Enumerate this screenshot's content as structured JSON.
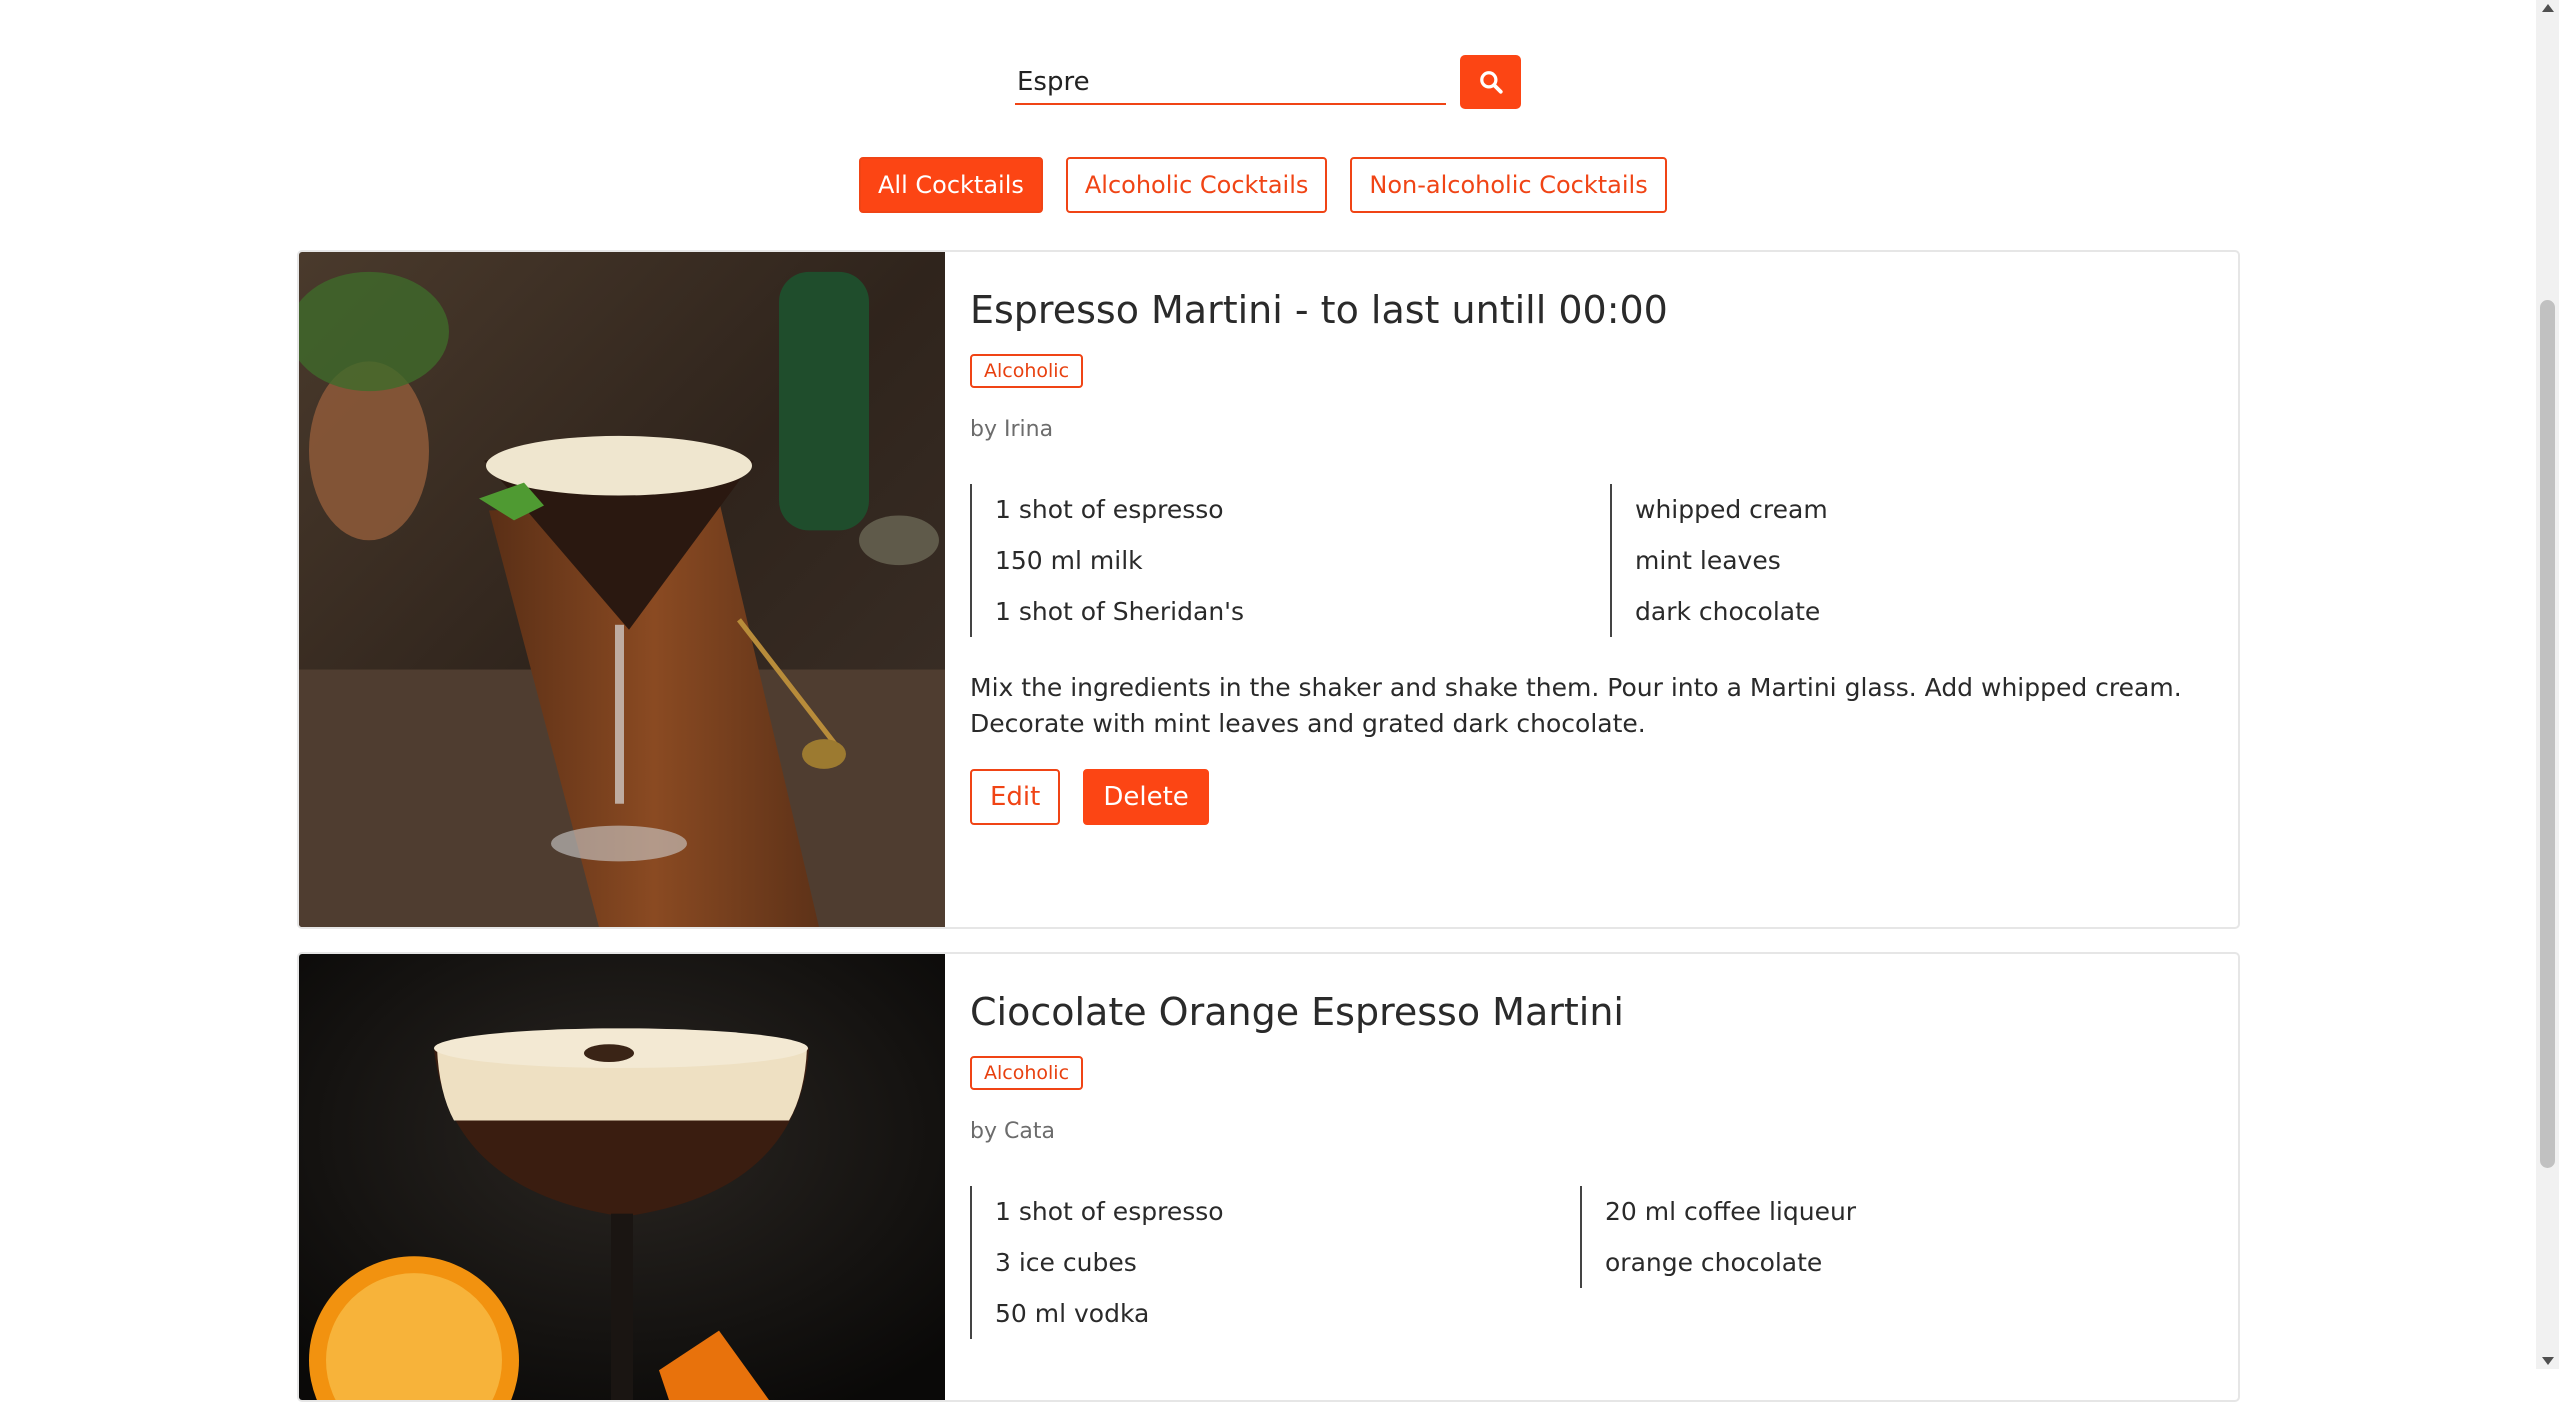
{
  "search": {
    "value": "Espre",
    "placeholder": ""
  },
  "filters": [
    {
      "label": "All Cocktails",
      "active": true
    },
    {
      "label": "Alcoholic Cocktails",
      "active": false
    },
    {
      "label": "Non-alcoholic Cocktails",
      "active": false
    }
  ],
  "cocktails": [
    {
      "title": "Espresso Martini - to last untill 00:00",
      "badge": "Alcoholic",
      "author": "by Irina",
      "ingredients_left": [
        "1 shot of espresso",
        "150 ml milk",
        "1 shot of Sheridan's"
      ],
      "ingredients_right": [
        "whipped cream",
        "mint leaves",
        "dark chocolate"
      ],
      "instructions": "Mix the ingredients in the shaker and shake them. Pour into a Martini glass. Add whipped cream. Decorate with mint leaves and grated dark chocolate.",
      "edit_label": "Edit",
      "delete_label": "Delete"
    },
    {
      "title": "Ciocolate Orange Espresso Martini",
      "badge": "Alcoholic",
      "author": "by Cata",
      "ingredients_left": [
        "1 shot of espresso",
        "3 ice cubes",
        "50 ml vodka"
      ],
      "ingredients_right": [
        "20 ml coffee liqueur",
        "orange chocolate"
      ]
    }
  ],
  "colors": {
    "accent": "#fc4514",
    "accent_border": "#f04415"
  }
}
